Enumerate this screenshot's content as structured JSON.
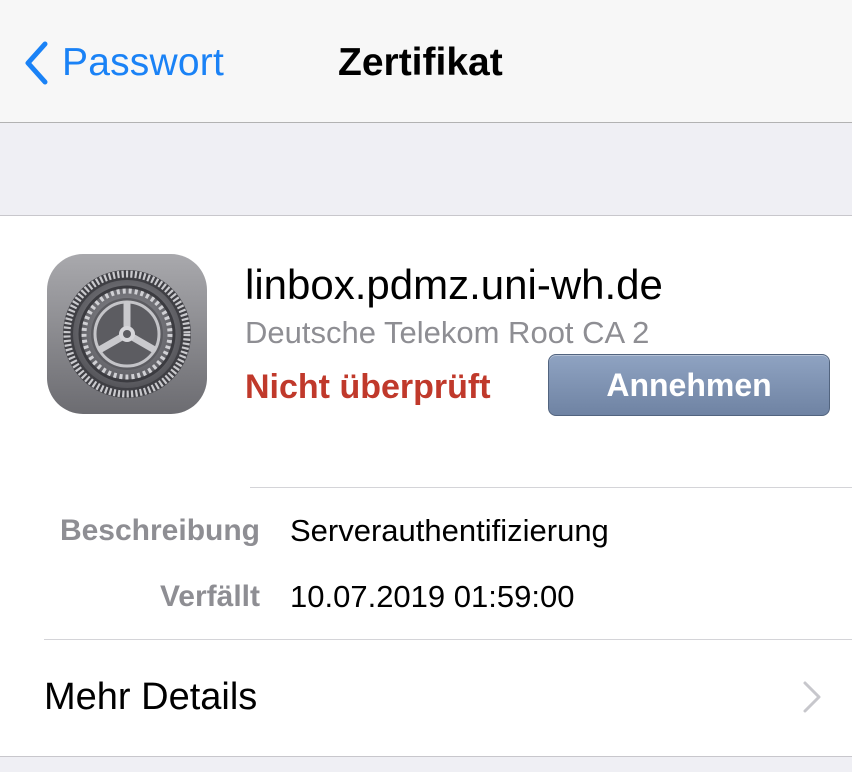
{
  "navbar": {
    "back_label": "Passwort",
    "title": "Zertifikat"
  },
  "certificate": {
    "icon": "settings-gear-icon",
    "name": "linbox.pdmz.uni-wh.de",
    "issuer": "Deutsche Telekom Root CA 2",
    "status": "Nicht überprüft",
    "accept_label": "Annehmen"
  },
  "details": [
    {
      "key": "Beschreibung",
      "value": "Serverauthentifizierung"
    },
    {
      "key": "Verfällt",
      "value": "10.07.2019 01:59:00"
    }
  ],
  "more": {
    "label": "Mehr Details",
    "icon": "chevron-right-icon"
  },
  "colors": {
    "accent": "#1a82f6",
    "status_untrusted": "#c0392b",
    "button": "#7b8fb0",
    "secondary_text": "#8e8e93"
  }
}
